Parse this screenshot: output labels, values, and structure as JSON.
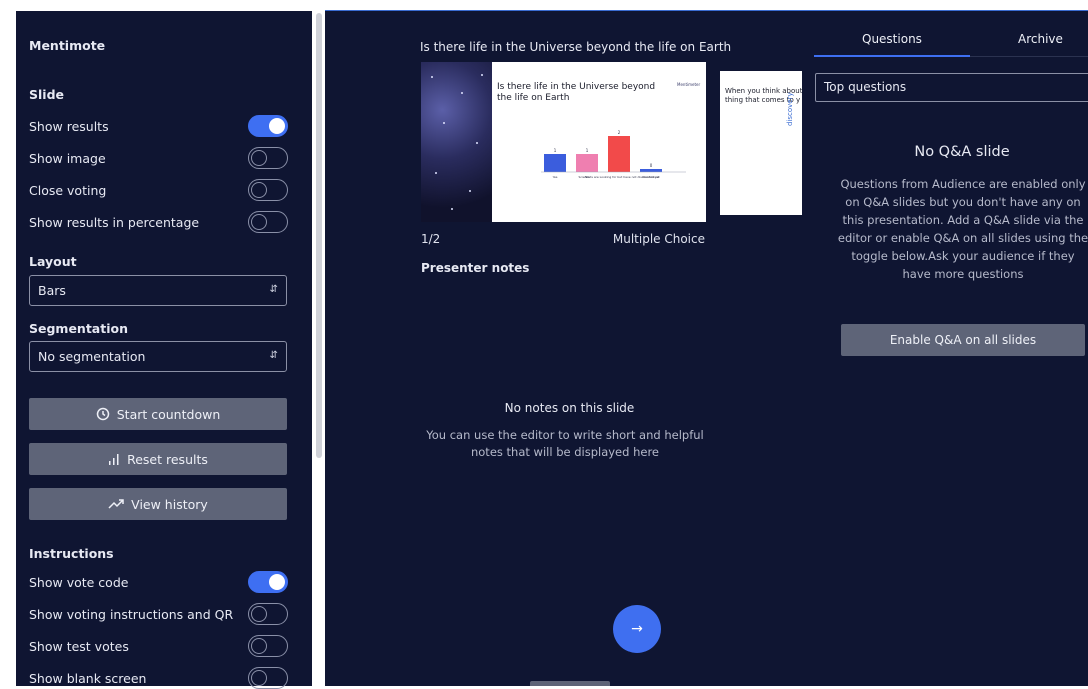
{
  "app": {
    "title": "Mentimote"
  },
  "sidebar": {
    "slide_heading": "Slide",
    "toggles": [
      {
        "label": "Show results",
        "on": true
      },
      {
        "label": "Show image",
        "on": false
      },
      {
        "label": "Close voting",
        "on": false
      },
      {
        "label": "Show results in percentage",
        "on": false
      }
    ],
    "layout": {
      "heading": "Layout",
      "value": "Bars"
    },
    "segmentation": {
      "heading": "Segmentation",
      "value": "No segmentation"
    },
    "buttons": {
      "start_countdown": "Start countdown",
      "reset_results": "Reset results",
      "view_history": "View history"
    },
    "instructions": {
      "heading": "Instructions",
      "toggles": [
        {
          "label": "Show vote code",
          "on": true
        },
        {
          "label": "Show voting instructions and QR",
          "on": false
        },
        {
          "label": "Show test votes",
          "on": false
        },
        {
          "label": "Show blank screen",
          "on": false
        }
      ]
    }
  },
  "presentation": {
    "title": "Is there life in the Universe beyond the life on Earth",
    "slide_heading": "Is there life in the Universe beyond the life on Earth",
    "slide_logo": "Mentimeter",
    "chart_data": {
      "type": "bar",
      "categories": [
        "Yes",
        "No",
        "Scientists are Looking for but have not discovered yet",
        "Don't know"
      ],
      "values": [
        1,
        1,
        2,
        0
      ],
      "colors": [
        "#3b5ddd",
        "#ef7fb0",
        "#f24a4a",
        "#3b5ddd"
      ]
    },
    "next_slide_text": "When you think about thing that comes to y",
    "next_slide_side": "discovery",
    "slide_counter": "1/2",
    "slide_type": "Multiple Choice",
    "notes_heading": "Presenter notes",
    "notes_empty_title": "No notes on this slide",
    "notes_empty_body": "You can use the editor to write short and helpful notes that will be displayed here",
    "next_icon": "arrow-right-icon"
  },
  "qa": {
    "tabs": [
      "Questions",
      "Archive"
    ],
    "active_tab": 0,
    "filter_value": "Top questions",
    "empty_title": "No Q&A slide",
    "empty_body": "Questions from Audience are enabled only on Q&A slides but you don't have any on this presentation. Add a Q&A slide via the editor or enable Q&A on all slides using the toggle below.Ask your audience if they have more questions",
    "enable_button": "Enable Q&A on all slides"
  },
  "colors": {
    "panel": "#0f1532",
    "accent": "#3e6ff2",
    "button": "#5e6478"
  }
}
